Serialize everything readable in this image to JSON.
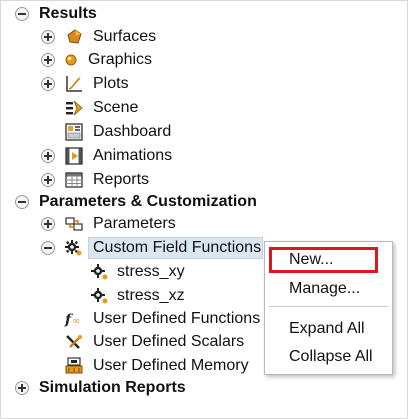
{
  "tree": {
    "results": {
      "label": "Results"
    },
    "surfaces": {
      "label": "Surfaces"
    },
    "graphics": {
      "label": "Graphics"
    },
    "plots": {
      "label": "Plots"
    },
    "scene": {
      "label": "Scene"
    },
    "dashboard": {
      "label": "Dashboard"
    },
    "animations": {
      "label": "Animations"
    },
    "reports": {
      "label": "Reports"
    },
    "params_custom": {
      "label": "Parameters & Customization"
    },
    "parameters": {
      "label": "Parameters"
    },
    "custom_field_functions": {
      "label": "Custom Field Functions"
    },
    "stress_xy": {
      "label": "stress_xy"
    },
    "stress_xz": {
      "label": "stress_xz"
    },
    "udf": {
      "label": "User Defined Functions"
    },
    "uds": {
      "label": "User Defined Scalars"
    },
    "udm": {
      "label": "User Defined Memory"
    },
    "sim_reports": {
      "label": "Simulation Reports"
    }
  },
  "context_menu": {
    "new": "New...",
    "manage": "Manage...",
    "expand_all": "Expand All",
    "collapse_all": "Collapse All"
  },
  "colors": {
    "highlight": "#e0161e",
    "selection": "#dbe6f3"
  }
}
